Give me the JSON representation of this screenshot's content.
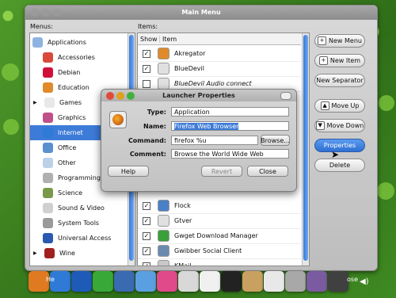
{
  "window": {
    "title": "Main Menu"
  },
  "menus_label": "Menus:",
  "items_label": "Items:",
  "tree": [
    {
      "label": "Applications",
      "color": "#8fb3e0"
    },
    {
      "label": "Accessories",
      "color": "#d94a3a"
    },
    {
      "label": "Debian",
      "color": "#d0103a"
    },
    {
      "label": "Education",
      "color": "#e08a2a"
    },
    {
      "label": "Games",
      "color": "#e8e8e8"
    },
    {
      "label": "Graphics",
      "color": "#c0508a"
    },
    {
      "label": "Internet",
      "color": "#2f7ad6"
    },
    {
      "label": "Office",
      "color": "#5a90d0"
    },
    {
      "label": "Other",
      "color": "#bcd0e8"
    },
    {
      "label": "Programming",
      "color": "#b0b0b0"
    },
    {
      "label": "Science",
      "color": "#7a9a4a"
    },
    {
      "label": "Sound & Video",
      "color": "#d0d0d0"
    },
    {
      "label": "System Tools",
      "color": "#9a9a9a"
    },
    {
      "label": "Universal Access",
      "color": "#2a5ab0"
    },
    {
      "label": "Wine",
      "color": "#a02020"
    }
  ],
  "items_header": {
    "show": "Show",
    "item": "Item"
  },
  "items": [
    {
      "label": "Akregator",
      "checked": true,
      "color": "#e08a2a"
    },
    {
      "label": "BlueDevil",
      "checked": true,
      "color": "#e0e0e0"
    },
    {
      "label": "BlueDevil Audio connect",
      "checked": false,
      "color": "#e0e0e0"
    },
    {
      "label": "Flock",
      "checked": true,
      "color": "#4a80c8"
    },
    {
      "label": "Gtver",
      "checked": true,
      "color": "#e0e0e0"
    },
    {
      "label": "Gwget Download Manager",
      "checked": true,
      "color": "#3aa03a"
    },
    {
      "label": "Gwibber Social Client",
      "checked": true,
      "color": "#6a8ab0"
    },
    {
      "label": "KMail",
      "checked": true,
      "color": "#c8c8c8"
    }
  ],
  "side_buttons": {
    "new_menu": "New Menu",
    "new_item": "New Item",
    "new_separator": "New Separator",
    "move_up": "Move Up",
    "move_down": "Move Down",
    "properties": "Properties",
    "delete": "Delete"
  },
  "dialog": {
    "title": "Launcher Properties",
    "type_label": "Type:",
    "type_value": "Application",
    "name_label": "Name:",
    "name_value": "Firefox Web Browser",
    "command_label": "Command:",
    "command_value": "firefox %u",
    "browse": "Browse...",
    "comment_label": "Comment:",
    "comment_value": "Browse the World Wide Web",
    "help": "Help",
    "revert": "Revert",
    "close": "Close"
  },
  "dock_icons": [
    "#e07a20",
    "#2f7ad6",
    "#1e5ab8",
    "#38a838",
    "#3a6ab0",
    "#5aa0e0",
    "#e04a8a",
    "#d8d8d8",
    "#f0f0f0",
    "#222222",
    "#c8a060",
    "#e8e8e8",
    "#a8a8a8",
    "#7a5aa0",
    "#404040"
  ],
  "dock_labels": {
    "left": "He",
    "right": "ose"
  }
}
